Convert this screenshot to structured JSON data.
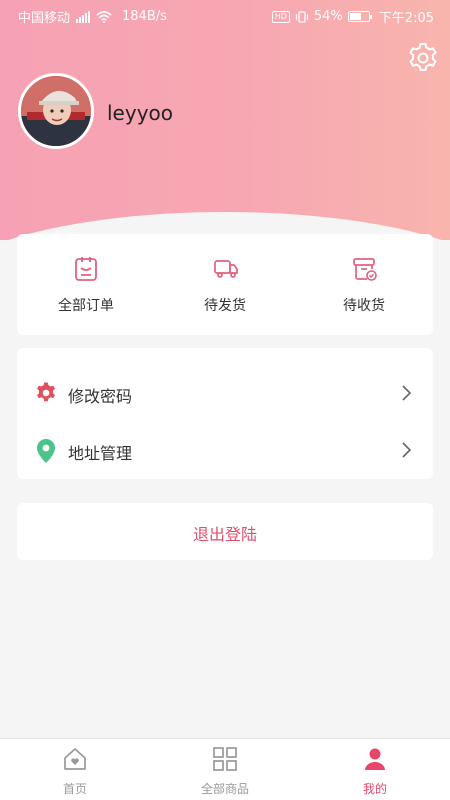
{
  "status_bar": {
    "carrier": "中国移动",
    "net_speed": "184B/s",
    "hd": "HD",
    "battery": "54%",
    "time": "下午2:05"
  },
  "profile": {
    "username": "leyyoo"
  },
  "orders": {
    "items": [
      {
        "label": "全部订单",
        "icon": "order-list-icon"
      },
      {
        "label": "待发货",
        "icon": "truck-icon"
      },
      {
        "label": "待收货",
        "icon": "package-check-icon"
      }
    ]
  },
  "menu": {
    "items": [
      {
        "label": "修改密码",
        "icon": "gear-icon",
        "icon_color": "#e0505f"
      },
      {
        "label": "地址管理",
        "icon": "location-pin-icon",
        "icon_color": "#4cc38a"
      }
    ]
  },
  "logout": {
    "label": "退出登陆"
  },
  "tabbar": {
    "items": [
      {
        "label": "首页",
        "icon": "home-heart-icon"
      },
      {
        "label": "全部商品",
        "icon": "grid-icon"
      },
      {
        "label": "我的",
        "icon": "user-icon"
      }
    ],
    "active_index": 2
  },
  "colors": {
    "accent": "#e8456a",
    "header_gradient_start": "#f6a2b4",
    "header_gradient_end": "#f8b5ad",
    "icon_pink": "#e2617f"
  }
}
